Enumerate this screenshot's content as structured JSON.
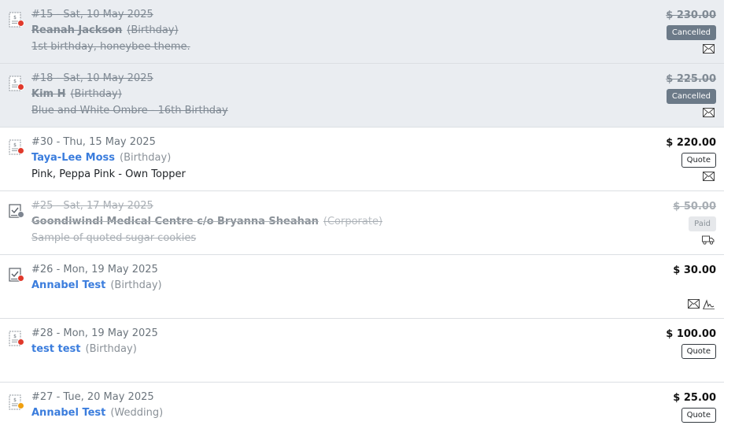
{
  "orders": [
    {
      "status": "cancelled",
      "dot_color": "#e0392b",
      "doc_icon": "invoice-icon",
      "line1": "#15 - Sat, 10 May 2025",
      "name": "Reanah Jackson",
      "type": "(Birthday)",
      "line3": "1st birthday, honeybee theme.",
      "price": "$ 230.00",
      "badge": "Cancelled",
      "action_icons": [
        "mail-icon"
      ]
    },
    {
      "status": "cancelled",
      "dot_color": "#e0392b",
      "doc_icon": "invoice-icon",
      "line1": "#18 - Sat, 10 May 2025",
      "name": "Kim H",
      "type": "(Birthday)",
      "line3": "Blue and White Ombre - 16th Birthday",
      "price": "$ 225.00",
      "badge": "Cancelled",
      "action_icons": [
        "mail-icon"
      ]
    },
    {
      "status": "quote",
      "dot_color": "#e0392b",
      "doc_icon": "invoice-icon",
      "line1": "#30 - Thu, 15 May 2025",
      "name": "Taya-Lee Moss",
      "type": "(Birthday)",
      "line3": "Pink, Peppa Pink - Own Topper",
      "price": "$ 220.00",
      "badge": "Quote",
      "action_icons": [
        "mail-icon"
      ]
    },
    {
      "status": "paid",
      "dot_color": "#7d8590",
      "doc_icon": "checklist-icon",
      "line1": "#25 - Sat, 17 May 2025",
      "name": "Goondiwindi Medical Centre c/o Bryanna Sheahan",
      "type": "(Corporate)",
      "line3": "Sample of quoted sugar cookies",
      "price": "$ 50.00",
      "badge": "Paid",
      "action_icons": [
        "truck-icon"
      ]
    },
    {
      "status": "plain",
      "dot_color": "#e0392b",
      "doc_icon": "checklist-icon",
      "line1": "#26 - Mon, 19 May 2025",
      "name": "Annabel Test",
      "type": "(Birthday)",
      "line3": "",
      "price": "$ 30.00",
      "badge": "",
      "action_icons": [
        "mail-icon",
        "signature-icon"
      ]
    },
    {
      "status": "quote",
      "dot_color": "#e0392b",
      "doc_icon": "invoice-icon",
      "line1": "#28 - Mon, 19 May 2025",
      "name": "test test",
      "type": "(Birthday)",
      "line3": "",
      "price": "$ 100.00",
      "badge": "Quote",
      "action_icons": []
    },
    {
      "status": "quote",
      "dot_color": "#f0a010",
      "doc_icon": "invoice-icon",
      "line1": "#27 - Tue, 20 May 2025",
      "name": "Annabel Test",
      "type": "(Wedding)",
      "line3": "",
      "price": "$ 25.00",
      "badge": "Quote",
      "action_icons": []
    }
  ]
}
